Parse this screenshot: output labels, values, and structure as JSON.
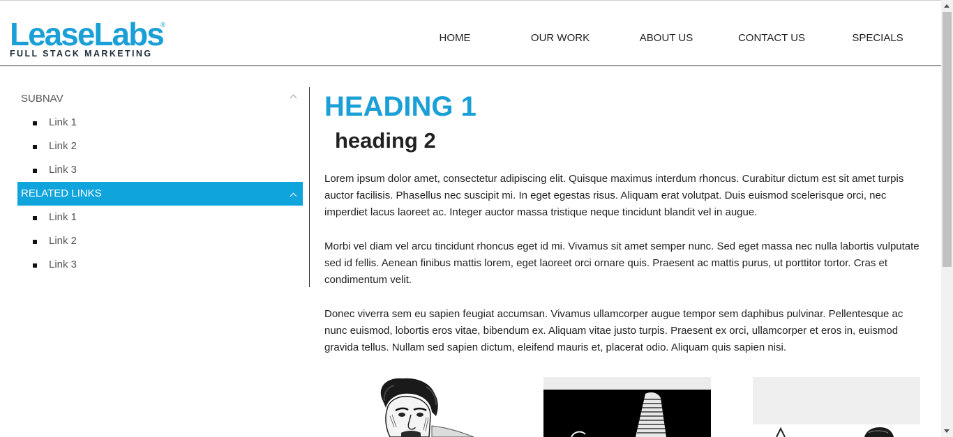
{
  "header": {
    "logo": {
      "brand": "LeaseLabs",
      "registered_mark": "®",
      "tagline": "FULL STACK MARKETING",
      "color": "#1a9fd6"
    },
    "nav": [
      {
        "label": "HOME"
      },
      {
        "label": "OUR WORK"
      },
      {
        "label": "ABOUT US"
      },
      {
        "label": "CONTACT US"
      },
      {
        "label": "SPECIALS"
      }
    ]
  },
  "sidebar": {
    "sections": [
      {
        "title": "SUBNAV",
        "active": false,
        "links": [
          {
            "label": "Link 1"
          },
          {
            "label": "Link 2"
          },
          {
            "label": "Link 3"
          }
        ]
      },
      {
        "title": "RELATED LINKS",
        "active": true,
        "active_color": "#0fa4dc",
        "links": [
          {
            "label": "Link 1"
          },
          {
            "label": "Link 2"
          },
          {
            "label": "Link 3"
          }
        ]
      }
    ],
    "icons": {
      "section_toggle": "chevron-up-icon",
      "list_marker": "square-bullet-icon"
    }
  },
  "content": {
    "heading1": "HEADING 1",
    "heading2": "heading 2",
    "paragraphs": [
      "Lorem ipsum dolor amet, consectetur adipiscing elit. Quisque maximus interdum rhoncus. Curabitur dictum est sit amet turpis auctor facilisis. Phasellus nec suscipit mi. In eget egestas risus. Aliquam erat volutpat. Duis euismod scelerisque orci, nec imperdiet lacus laoreet ac. Integer auctor massa tristique neque tincidunt blandit vel in augue.",
      "Morbi vel diam vel arcu tincidunt rhoncus eget id mi. Vivamus sit amet semper nunc. Sed eget massa nec nulla labortis vulputate sed id fellis. Aenean finibus mattis lorem, eget laoreet orci ornare quis. Praesent ac mattis purus, ut porttitor tortor. Cras et condimentum velit.",
      "Donec viverra sem eu sapien feugiat accumsan. Vivamus ullamcorper augue tempor sem daphibus pulvinar. Pellentesque ac nunc euismod, lobortis eros vitae, bibendum ex. Aliquam vitae justo turpis. Praesent ex orci, ullamcorper et eros in, euismod gravida tellus. Nullam sed sapien dictum, eleifend mauris et, placerat odio. Aliquam quis sapien nisi."
    ],
    "images": [
      {
        "kind": "engraving-portrait"
      },
      {
        "kind": "engraving-hat"
      },
      {
        "kind": "engraving-figure"
      }
    ]
  },
  "colors": {
    "accent": "#1a9fd6",
    "text": "#222222",
    "muted": "#555555"
  }
}
